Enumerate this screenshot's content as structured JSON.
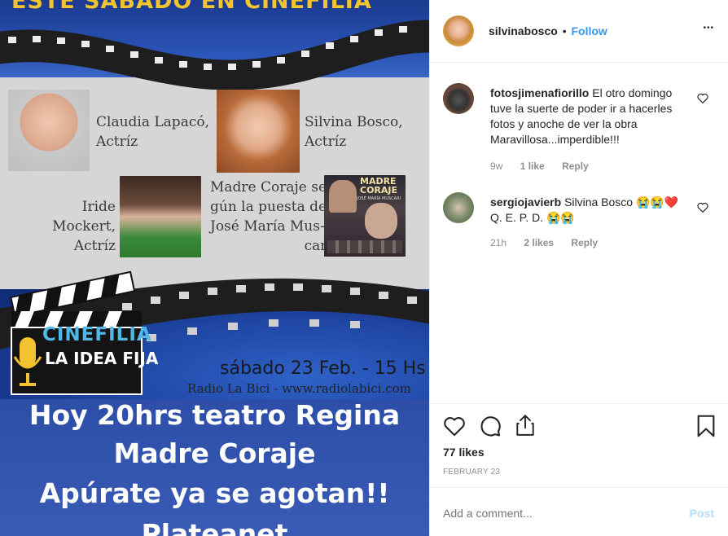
{
  "poster": {
    "headline": "ESTE SABADO EN CINEFILIA",
    "actors": [
      {
        "name": "Claudia Lapacó,",
        "role": "Actríz"
      },
      {
        "name": "Silvina Bosco,",
        "role": "Actríz"
      },
      {
        "name": "Iride Mockert,",
        "role": "Actríz"
      }
    ],
    "play_text": [
      "Madre Coraje se-",
      "gún la puesta de",
      "José María Mus-",
      "cari"
    ],
    "play_poster_title": [
      "MADRE",
      "CORAJE"
    ],
    "play_poster_subtitle": "JOSÉ MARÍA MUSCARI",
    "logo_title": "CINEFILIA",
    "logo_subtitle": "LA IDEA FIJA",
    "date": "sábado 23 Feb. - 15 Hs",
    "radio": "Radio La Bici - www.radiolabici.com"
  },
  "story": {
    "lines": [
      "Hoy 20hrs teatro Regina",
      "Madre Coraje",
      "Apúrate ya se agotan!!",
      "Plateanet"
    ]
  },
  "header": {
    "username": "silvinabosco",
    "separator": "•",
    "follow_label": "Follow",
    "more_label": "•••"
  },
  "comments": [
    {
      "username": "fotosjimenafiorillo",
      "text": "El otro domingo tuve la suerte de poder ir a hacerles fotos y anoche de ver la obra Maravillosa...imperdible!!!",
      "time": "9w",
      "likes": "1 like",
      "reply": "Reply"
    },
    {
      "username": "sergiojavierb",
      "text": "Silvina Bosco 😭😭❤️",
      "text2": "Q. E. P. D. 😭😭",
      "time": "21h",
      "likes": "2 likes",
      "reply": "Reply"
    }
  ],
  "post": {
    "likes": "77 likes",
    "date": "FEBRUARY 23",
    "comment_placeholder": "Add a comment...",
    "post_label": "Post"
  },
  "colors": {
    "follow": "#3897f0",
    "post_disabled": "#b2dffc",
    "meta": "#8e8e8e"
  }
}
